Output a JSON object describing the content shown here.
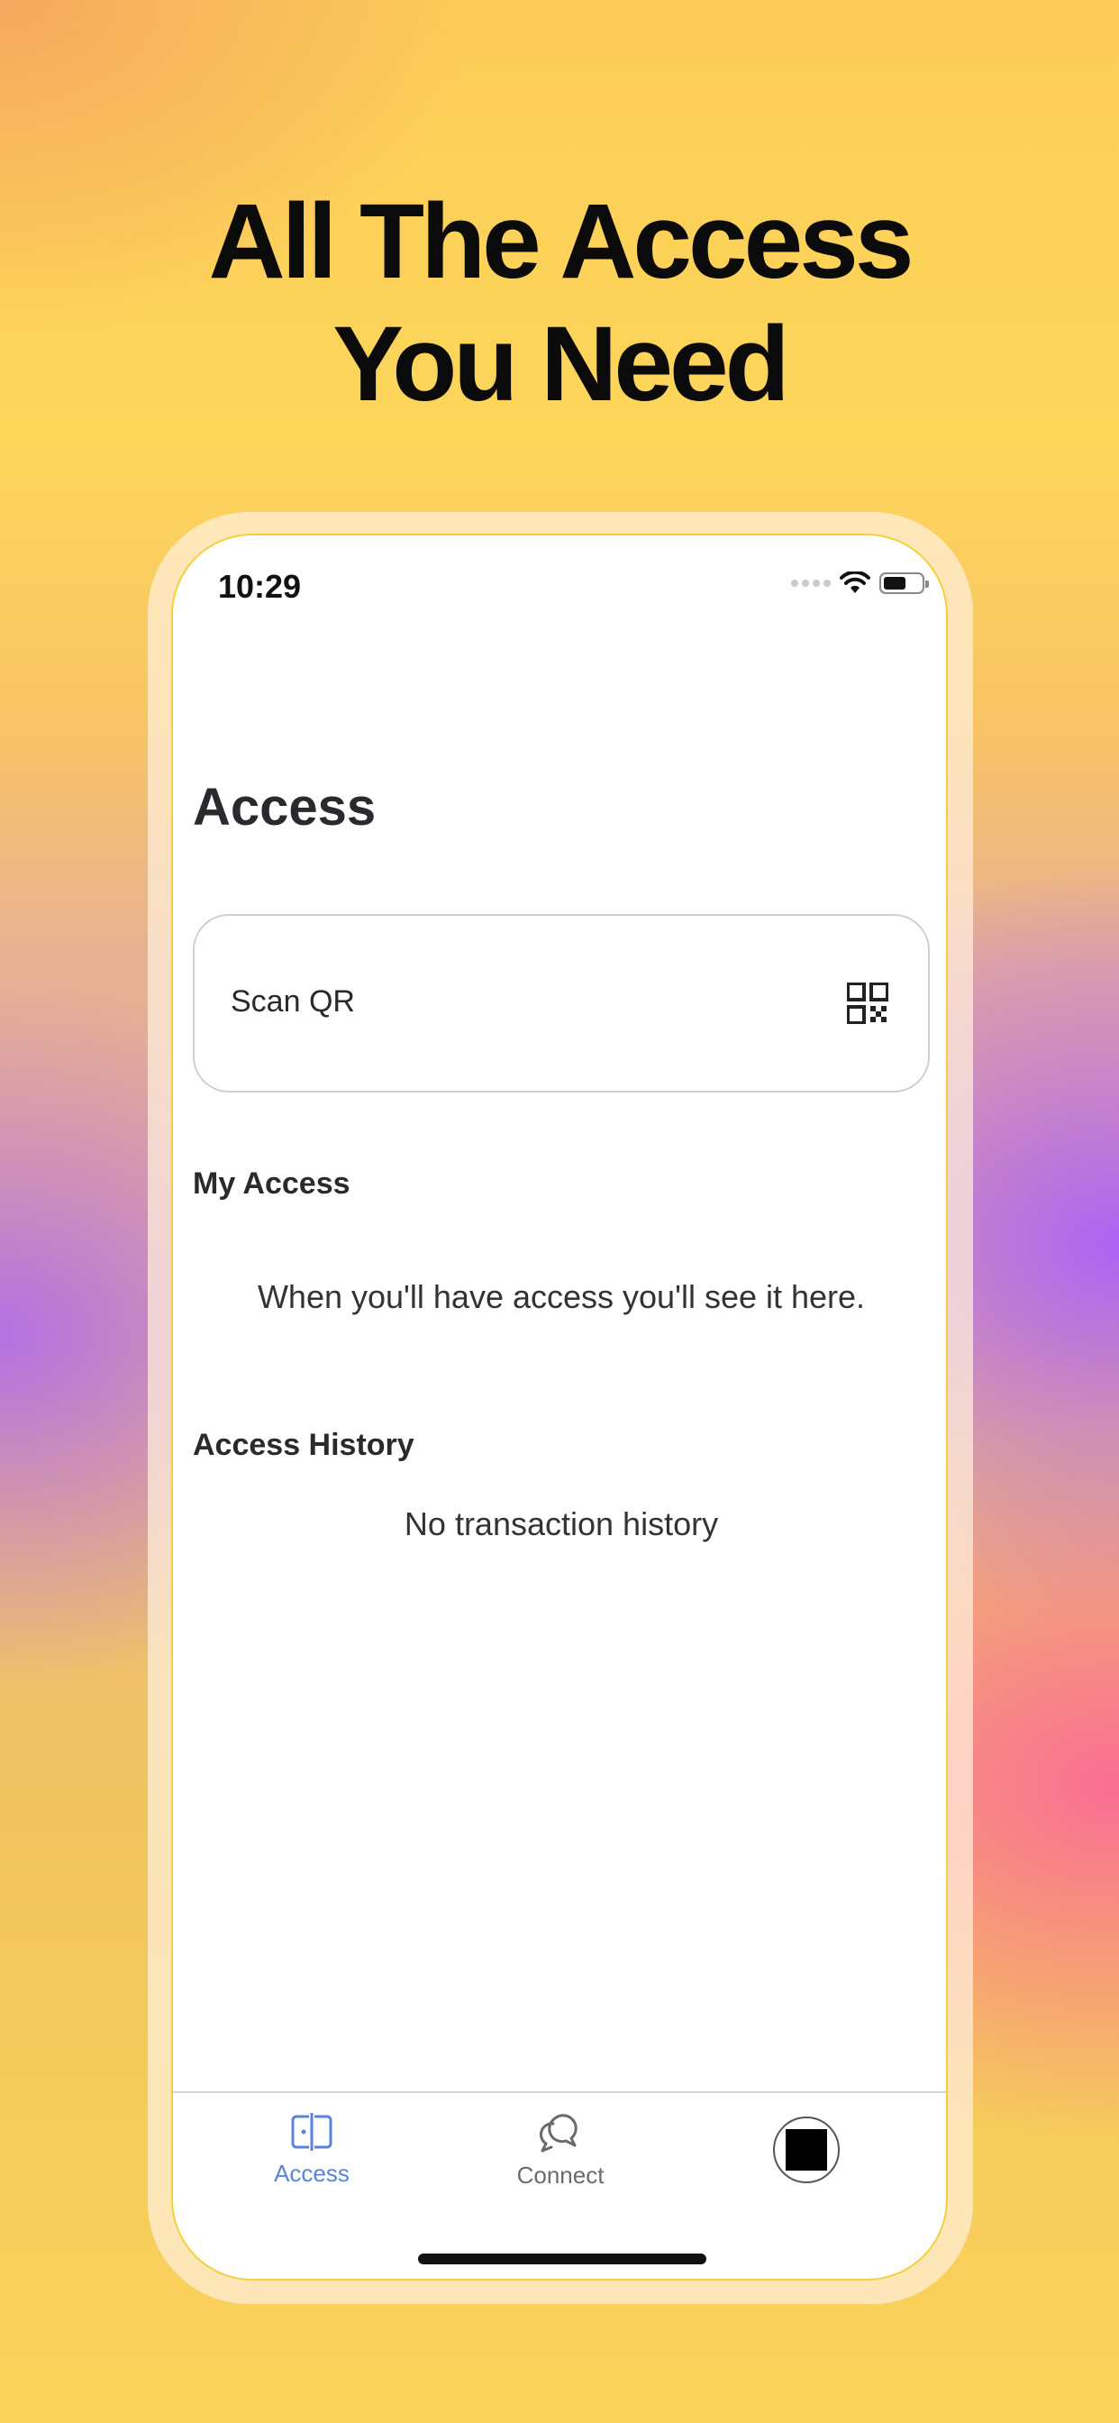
{
  "headline": {
    "line1": "All The Access",
    "line2": "You Need"
  },
  "status_bar": {
    "time": "10:29",
    "battery_level": 0.6
  },
  "page": {
    "title": "Access"
  },
  "scan_card": {
    "label": "Scan QR",
    "icon": "qr-code-icon"
  },
  "my_access": {
    "title": "My Access",
    "empty_message": "When you'll have access you'll see it here."
  },
  "access_history": {
    "title": "Access History",
    "empty_message": "No transaction history"
  },
  "tab_bar": {
    "items": [
      {
        "label": "Access",
        "icon": "access-icon",
        "active": true
      },
      {
        "label": "Connect",
        "icon": "chat-bubbles-icon",
        "active": false
      },
      {
        "label": "",
        "icon": "profile-avatar-icon",
        "active": false
      }
    ],
    "active_color": "#5b83dc",
    "inactive_color": "#6a6a6a"
  },
  "colors": {
    "accent": "#5b83dc",
    "text_primary": "#2a2a2e"
  }
}
